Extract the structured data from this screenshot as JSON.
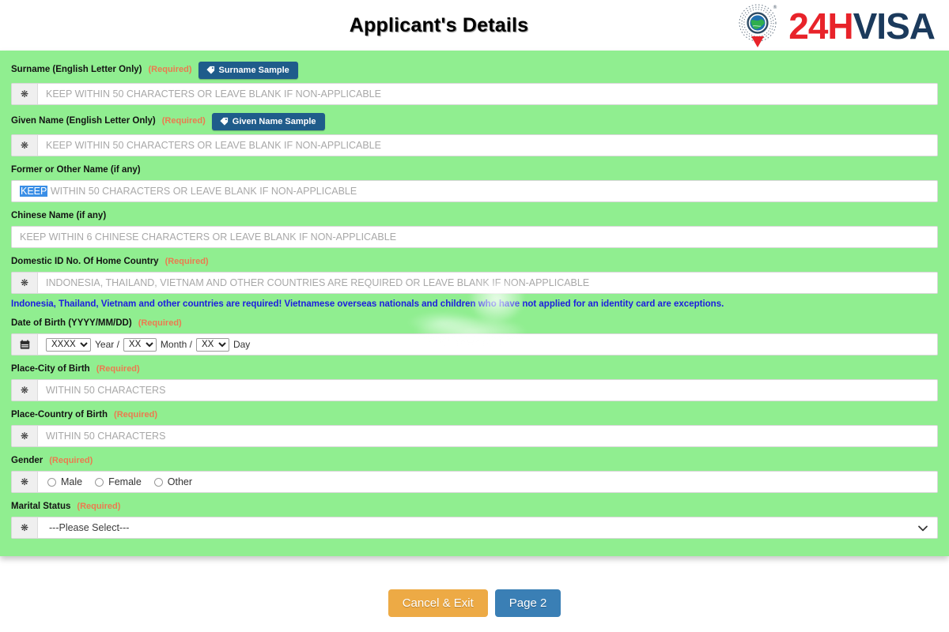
{
  "header": {
    "title": "Applicant's Details",
    "logo": {
      "mark_icon": "globe-pin-icon",
      "text_primary": "24H",
      "text_secondary": "VISA",
      "color_primary": "#e8232a",
      "color_secondary": "#1b3a5c"
    }
  },
  "theme": {
    "panel_bg": "#90ee90",
    "required_color": "#ec7a4f",
    "note_color": "#1c1ce0",
    "sample_btn_bg": "#1f5c8b",
    "cancel_btn_bg": "#edaa45",
    "next_btn_bg": "#3a7fb5",
    "selection_bg": "#3a8ee6"
  },
  "form": {
    "required_tag": "(Required)",
    "prefix_icon": "asterisk-icon",
    "fields": {
      "surname": {
        "label": "Surname (English Letter Only)",
        "required": "(Required)",
        "sample_button": "Surname Sample",
        "placeholder": "KEEP WITHIN 50 CHARACTERS OR LEAVE BLANK IF NON-APPLICABLE",
        "value": ""
      },
      "given_name": {
        "label": "Given Name (English Letter Only)",
        "required": "(Required)",
        "sample_button": "Given Name Sample",
        "placeholder": "KEEP WITHIN 50 CHARACTERS OR LEAVE BLANK IF NON-APPLICABLE",
        "value": ""
      },
      "former_name": {
        "label": "Former or Other Name (if any)",
        "placeholder_selected": "KEEP",
        "placeholder_rest": " WITHIN 50 CHARACTERS OR LEAVE BLANK IF NON-APPLICABLE",
        "value": ""
      },
      "chinese_name": {
        "label": "Chinese Name (if any)",
        "placeholder": "KEEP WITHIN 6 CHINESE CHARACTERS OR LEAVE BLANK IF NON-APPLICABLE",
        "value": ""
      },
      "domestic_id": {
        "label": "Domestic ID No. Of Home Country",
        "required": "(Required)",
        "placeholder": "INDONESIA, THAILAND, VIETNAM AND OTHER COUNTRIES ARE REQUIRED OR LEAVE BLANK IF NON-APPLICABLE",
        "value": "",
        "note": "Indonesia, Thailand, Vietnam and other countries are required! Vietnamese overseas nationals and children who have not applied for an identity card are exceptions."
      },
      "date_of_birth": {
        "label": "Date of Birth (YYYY/MM/DD)",
        "required": "(Required)",
        "icon": "calendar-icon",
        "year_value": "XXXX",
        "year_suffix": "Year /",
        "month_value": "XX",
        "month_suffix": "Month /",
        "day_value": "XX",
        "day_suffix": "Day"
      },
      "place_city": {
        "label": "Place-City of Birth",
        "required": "(Required)",
        "placeholder": "WITHIN 50 CHARACTERS",
        "value": ""
      },
      "place_country": {
        "label": "Place-Country of Birth",
        "required": "(Required)",
        "placeholder": "WITHIN 50 CHARACTERS",
        "value": ""
      },
      "gender": {
        "label": "Gender",
        "required": "(Required)",
        "options": [
          "Male",
          "Female",
          "Other"
        ],
        "selected": ""
      },
      "marital_status": {
        "label": "Marital Status",
        "required": "(Required)",
        "selected": "---Please Select---",
        "chevron": "˅"
      }
    }
  },
  "footer": {
    "cancel_label": "Cancel & Exit",
    "next_label": "Page 2"
  }
}
